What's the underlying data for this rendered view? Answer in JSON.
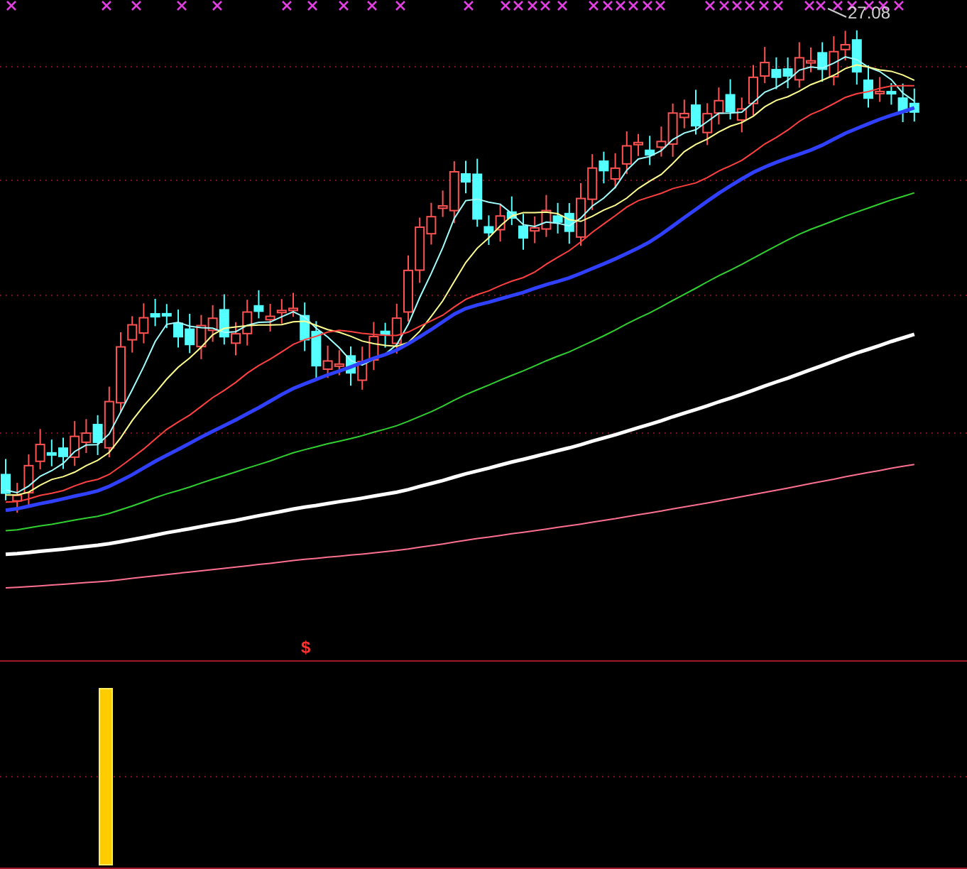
{
  "main_chart": {
    "high_price_label": "27.08",
    "signal_label": "$"
  }
}
